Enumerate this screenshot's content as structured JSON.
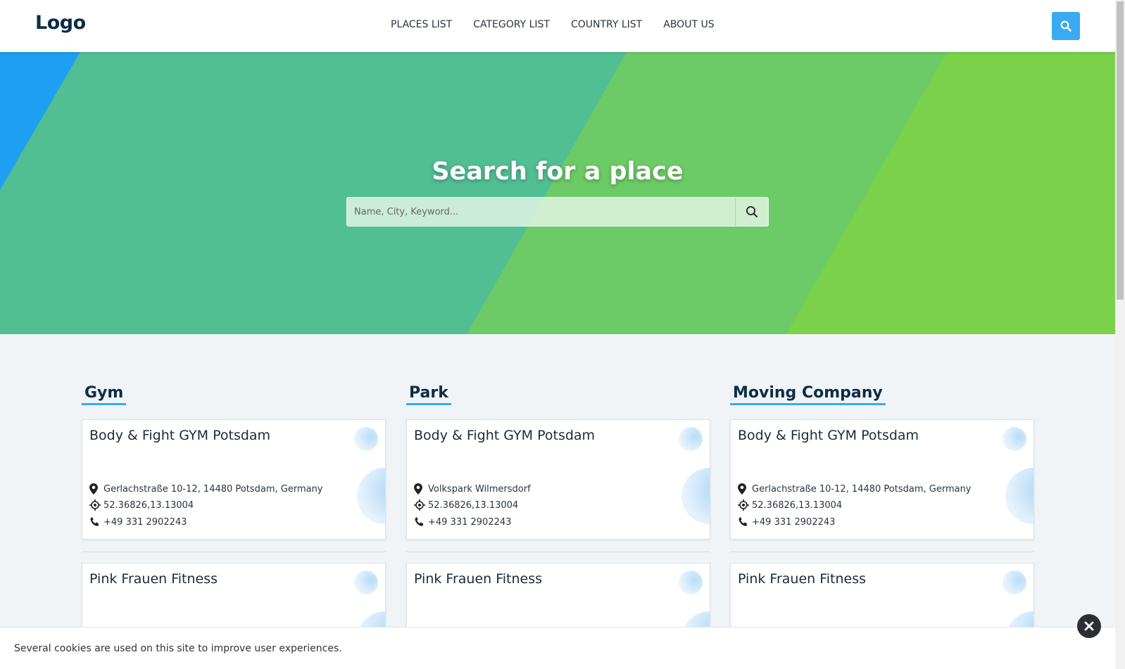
{
  "header": {
    "logo": "Logo",
    "nav": [
      "PLACES LIST",
      "CATEGORY LIST",
      "COUNTRY LIST",
      "ABOUT US"
    ],
    "search_icon": "search-icon"
  },
  "hero": {
    "title": "Search for a place",
    "search_placeholder": "Name, City, Keyword...",
    "search_value": "",
    "colors": {
      "blue": "#1e9ff2",
      "teal": "#52be94",
      "green": "#6ccb66",
      "lime": "#7bd24a"
    }
  },
  "columns": [
    {
      "title": "Gym",
      "cards": [
        {
          "name": "Body & Fight GYM Potsdam",
          "address": "Gerlachstraße 10-12, 14480 Potsdam, Germany",
          "coords": "52.36826,13.13004",
          "phone": "+49 331 2902243"
        },
        {
          "name": "Pink Frauen Fitness"
        }
      ]
    },
    {
      "title": "Park",
      "cards": [
        {
          "name": "Body & Fight GYM Potsdam",
          "address": "Volkspark Wilmersdorf",
          "coords": "52.36826,13.13004",
          "phone": "+49 331 2902243"
        },
        {
          "name": "Pink Frauen Fitness"
        }
      ]
    },
    {
      "title": "Moving Company",
      "cards": [
        {
          "name": "Body & Fight GYM Potsdam",
          "address": "Gerlachstraße 10-12, 14480 Potsdam, Germany",
          "coords": "52.36826,13.13004",
          "phone": "+49 331 2902243"
        },
        {
          "name": "Pink Frauen Fitness"
        }
      ]
    }
  ],
  "cookie": {
    "text": "Several cookies are used on this site to improve user experiences.",
    "close_icon": "close-icon"
  }
}
